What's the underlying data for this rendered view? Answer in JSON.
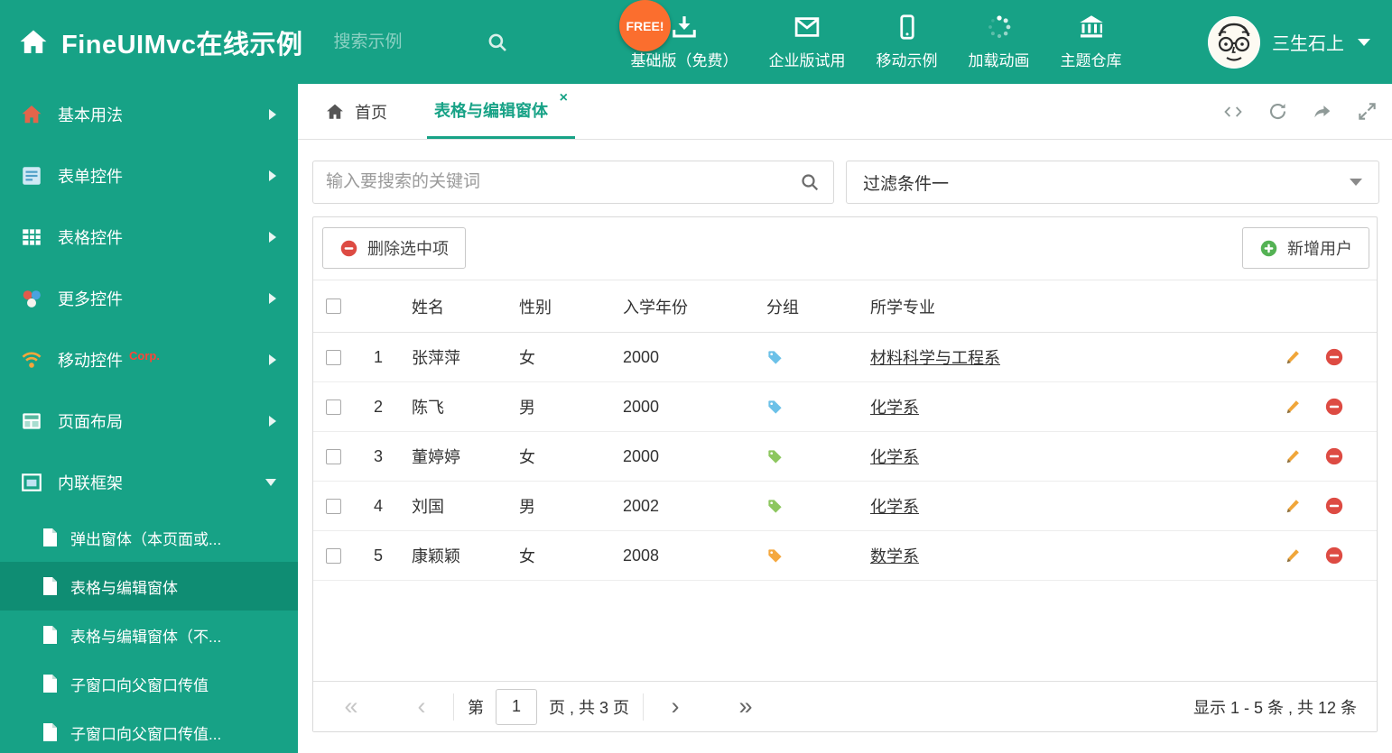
{
  "header": {
    "title": "FineUIMvc在线示例",
    "search_placeholder": "搜索示例",
    "free_badge": "FREE!",
    "nav": [
      {
        "label": "基础版（免费）",
        "icon": "download-icon"
      },
      {
        "label": "企业版试用",
        "icon": "envelope-icon"
      },
      {
        "label": "移动示例",
        "icon": "mobile-icon"
      },
      {
        "label": "加载动画",
        "icon": "spinner-icon"
      },
      {
        "label": "主题仓库",
        "icon": "bank-icon"
      }
    ],
    "user_name": "三生石上"
  },
  "sidebar": {
    "items": [
      {
        "label": "基本用法"
      },
      {
        "label": "表单控件"
      },
      {
        "label": "表格控件"
      },
      {
        "label": "更多控件"
      },
      {
        "label": "移动控件",
        "badge": "Corp."
      },
      {
        "label": "页面布局"
      },
      {
        "label": "内联框架"
      }
    ],
    "subitems": [
      {
        "label": "弹出窗体（本页面或..."
      },
      {
        "label": "表格与编辑窗体"
      },
      {
        "label": "表格与编辑窗体（不..."
      },
      {
        "label": "子窗口向父窗口传值"
      },
      {
        "label": "子窗口向父窗口传值..."
      }
    ]
  },
  "tabs": {
    "home": "首页",
    "active": "表格与编辑窗体",
    "close": "×"
  },
  "filter": {
    "search_placeholder": "输入要搜索的关键词",
    "dropdown_value": "过滤条件一"
  },
  "toolbar": {
    "delete_label": "删除选中项",
    "add_label": "新增用户"
  },
  "table": {
    "columns": [
      "姓名",
      "性别",
      "入学年份",
      "分组",
      "所学专业"
    ],
    "rows": [
      {
        "num": "1",
        "name": "张萍萍",
        "gender": "女",
        "year": "2000",
        "tag_color": "#6cc1e8",
        "major": "材料科学与工程系"
      },
      {
        "num": "2",
        "name": "陈飞",
        "gender": "男",
        "year": "2000",
        "tag_color": "#6cc1e8",
        "major": "化学系"
      },
      {
        "num": "3",
        "name": "董婷婷",
        "gender": "女",
        "year": "2000",
        "tag_color": "#8dc75f",
        "major": "化学系"
      },
      {
        "num": "4",
        "name": "刘国",
        "gender": "男",
        "year": "2002",
        "tag_color": "#8dc75f",
        "major": "化学系"
      },
      {
        "num": "5",
        "name": "康颖颖",
        "gender": "女",
        "year": "2008",
        "tag_color": "#f5a83e",
        "major": "数学系"
      }
    ]
  },
  "pagination": {
    "prefix": "第",
    "current": "1",
    "suffix": "页 , 共 3 页",
    "summary": "显示 1 - 5 条 , 共 12 条"
  },
  "colors": {
    "theme": "#17a286",
    "theme_dark": "#0f8d73",
    "free_badge": "#fb6e2e",
    "danger": "#dd4b43",
    "success": "#54b254",
    "pencil": "#f0a63a"
  }
}
